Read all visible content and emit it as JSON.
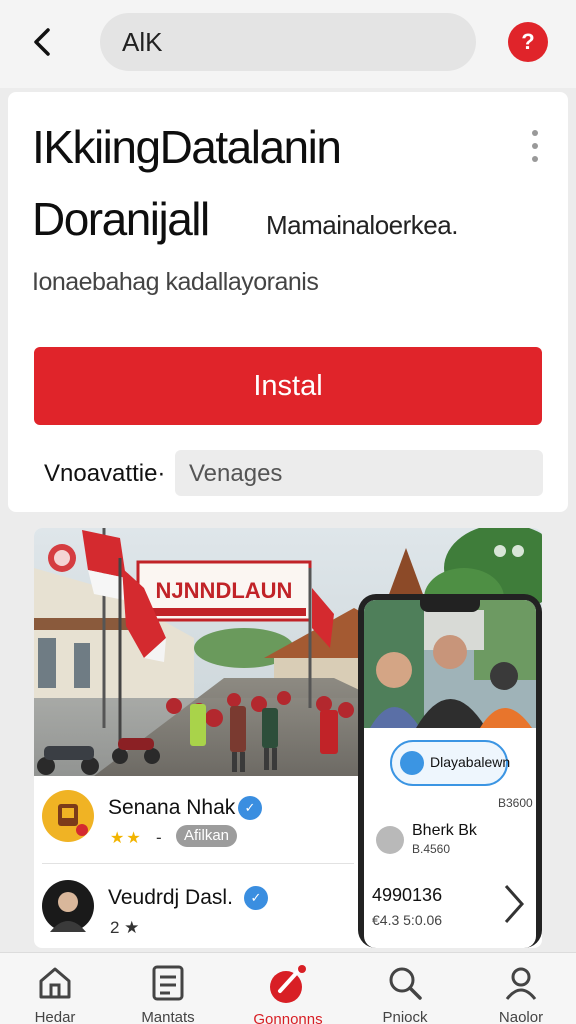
{
  "header": {
    "search_text": "AlK",
    "help_label": "?"
  },
  "app": {
    "title_line1": "IKkiingDatalanin",
    "title_line2": "Doranijall",
    "developer": "Mamainaloerkea.",
    "subtitle": "Ionaebahag kadallayoranis",
    "install_label": "Instal",
    "meta_label": "Vnoavattie·",
    "meta_value": "Venages"
  },
  "gallery": {
    "banner_text": "NJNNDLAUN",
    "reviews": [
      {
        "name": "Senana Nhak",
        "stars": "★★",
        "separator": "-",
        "badge": "Afilkan"
      },
      {
        "name": "Veudrdj Dasl.",
        "sub": "2 ★"
      }
    ],
    "phone": {
      "chip_label": "Dlayabalewn",
      "small_top": "B3600",
      "name": "Bherk Bk",
      "small_name": "B.4560",
      "number": "4990136",
      "number_sub": "€4.3 5:0.06"
    }
  },
  "nav": {
    "items": [
      {
        "label": "Hedar"
      },
      {
        "label": "Mantats"
      },
      {
        "label": "Gonnonns"
      },
      {
        "label": "Pniock"
      },
      {
        "label": "Naolor"
      }
    ]
  },
  "colors": {
    "accent": "#e0242a",
    "verified": "#3a8ee0"
  }
}
